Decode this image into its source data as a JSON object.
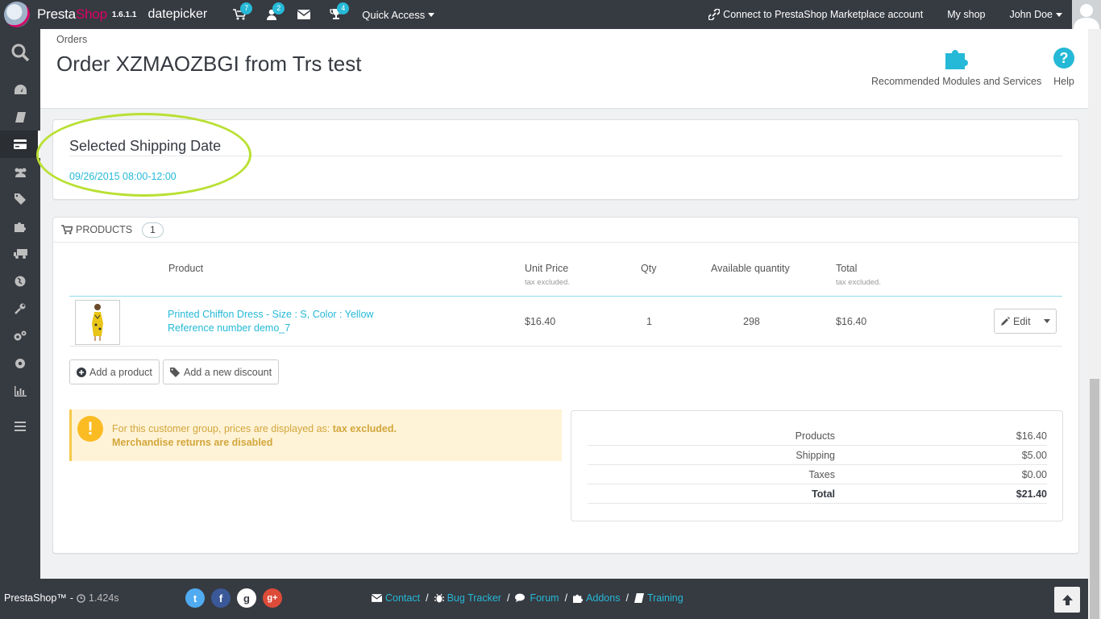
{
  "header": {
    "brand_presta": "Presta",
    "brand_shop": "Shop",
    "version": "1.6.1.1",
    "shop_name": "datepicker",
    "badges": {
      "orders": "7",
      "customers": "2",
      "achievements": "4"
    },
    "quick_access": "Quick Access",
    "marketplace": "Connect to PrestaShop Marketplace account",
    "my_shop": "My shop",
    "user": "John Doe"
  },
  "pagehead": {
    "breadcrumb": "Orders",
    "title": "Order XZMAOZBGI from Trs test",
    "tools": {
      "modules": "Recommended Modules and Services",
      "help": "Help"
    }
  },
  "shipping": {
    "title": "Selected Shipping Date",
    "date": "09/26/2015 08:00-12:00"
  },
  "products": {
    "heading": "PRODUCTS",
    "count": "1",
    "columns": {
      "product": "Product",
      "unit_price": "Unit Price",
      "unit_price_sub": "tax excluded.",
      "qty": "Qty",
      "available": "Available quantity",
      "total": "Total",
      "total_sub": "tax excluded."
    },
    "rows": [
      {
        "name": "Printed Chiffon Dress - Size : S, Color : Yellow",
        "reference": "Reference number demo_7",
        "unit_price": "$16.40",
        "qty": "1",
        "available": "298",
        "total": "$16.40"
      }
    ],
    "edit_label": "Edit",
    "add_product": "Add a product",
    "add_discount": "Add a new discount"
  },
  "warning": {
    "line1_prefix": "For this customer group, prices are displayed as:",
    "line1_strong": "tax excluded.",
    "line2": "Merchandise returns are disabled"
  },
  "totals": [
    {
      "label": "Products",
      "value": "$16.40"
    },
    {
      "label": "Shipping",
      "value": "$5.00"
    },
    {
      "label": "Taxes",
      "value": "$0.00"
    },
    {
      "label": "Total",
      "value": "$21.40"
    }
  ],
  "footer": {
    "brand": "PrestaShop™",
    "dash": "-",
    "time": "1.424s",
    "links": {
      "contact": "Contact",
      "bug": "Bug Tracker",
      "forum": "Forum",
      "addons": "Addons",
      "training": "Training"
    },
    "sep": "/",
    "social": {
      "twitter": "t",
      "facebook": "f",
      "github": "g",
      "google": "g+"
    }
  },
  "colors": {
    "accent": "#25b9d7",
    "sidebar": "#363a41",
    "brand_pink": "#df0067",
    "highlight": "#b9e033",
    "warning_bg": "#fff3d7"
  }
}
